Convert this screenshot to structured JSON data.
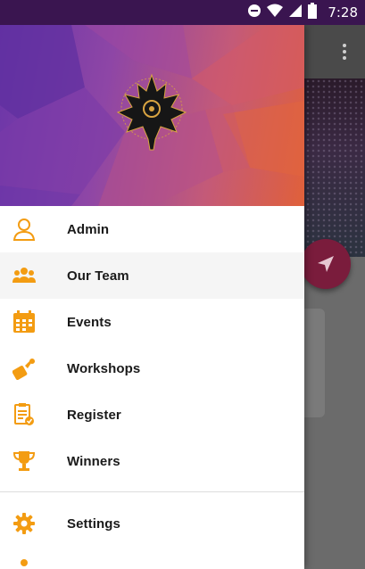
{
  "status_bar": {
    "time": "7:28",
    "icons": [
      "do-not-disturb-icon",
      "wifi-icon",
      "signal-icon",
      "battery-icon"
    ]
  },
  "drawer": {
    "header_logo": "maple-leaf-logo",
    "items": [
      {
        "label": "Admin",
        "icon": "admin-user-icon"
      },
      {
        "label": "Our Team",
        "icon": "team-icon",
        "active": true
      },
      {
        "label": "Events",
        "icon": "calendar-icon"
      },
      {
        "label": "Workshops",
        "icon": "workshop-tools-icon"
      },
      {
        "label": "Register",
        "icon": "register-clipboard-icon"
      },
      {
        "label": "Winners",
        "icon": "trophy-icon"
      }
    ],
    "secondary_items": [
      {
        "label": "Settings",
        "icon": "settings-gear-icon"
      }
    ]
  },
  "colors": {
    "accent": "#f39c12",
    "status_bar": "#3a1550",
    "fab": "#7a1c3c"
  }
}
